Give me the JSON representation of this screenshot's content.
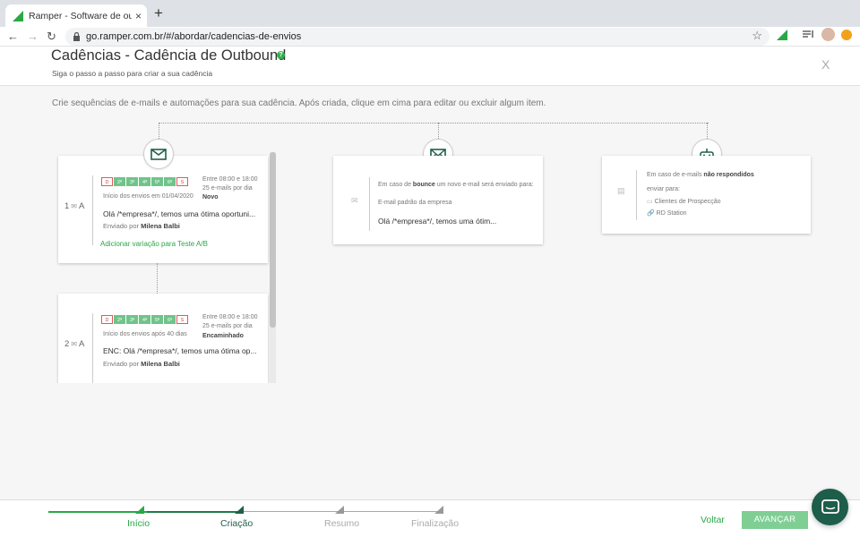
{
  "browser": {
    "tab_title": "Ramper - Software de outbound",
    "tab_close": "×",
    "new_tab": "+",
    "url": "go.ramper.com.br/#/abordar/cadencias-de-envios"
  },
  "header": {
    "title": "Cadências - Cadência de Outbound",
    "help": "?",
    "subtitle": "Siga o passo a passo para criar a sua cadência",
    "close": "X"
  },
  "description": "Crie sequências de e-mails e automações para sua cadência. Após criada, clique em cima para editar ou excluir algum item.",
  "steps": [
    {
      "number": "1",
      "suffix": "A",
      "days": [
        "D",
        "2ª",
        "3ª",
        "4ª",
        "5ª",
        "6ª",
        "S"
      ],
      "start": "Início dos envios em 01/04/2020",
      "window": "Entre 08:00 e 18:00",
      "per_day": "25 e-mails por dia",
      "status": "Novo",
      "subject": "Olá /*empresa*/, temos uma ótima oportuni...",
      "sent_by_label": "Enviado por",
      "sent_by": "Milena Balbi",
      "ab_link": "Adicionar variação para Teste A/B"
    },
    {
      "number": "2",
      "suffix": "A",
      "days": [
        "D",
        "2ª",
        "3ª",
        "4ª",
        "5ª",
        "6ª",
        "S"
      ],
      "start": "Início dos envios após 40 dias",
      "window": "Entre 08:00 e 18:00",
      "per_day": "25 e-mails por dia",
      "status": "Encaminhado",
      "subject": "ENC: Olá /*empresa*/, temos uma ótima op...",
      "sent_by_label": "Enviado por",
      "sent_by": "Milena Balbi"
    }
  ],
  "bounce": {
    "text_pre": "Em caso de",
    "text_bold": "bounce",
    "text_post": "um novo e-mail será enviado para:",
    "source": "E-mail padrão da empresa",
    "subject": "Olá /*empresa*/, temos uma ótim..."
  },
  "no_reply": {
    "text_pre": "Em caso de e-mails",
    "text_bold": "não respondidos",
    "send_to": "enviar para:",
    "folder": "Clientes de Prospecção",
    "integration": "RD Station"
  },
  "footer": {
    "steps": [
      "Início",
      "Criação",
      "Resumo",
      "Finalização"
    ],
    "back": "Voltar",
    "next": "AVANÇAR"
  },
  "colors": {
    "brand_green": "#29a847",
    "dark_green": "#1f7a4a",
    "day_on": "#6fc48a",
    "day_off": "#e05a5a",
    "chat": "#1d5d4a"
  }
}
